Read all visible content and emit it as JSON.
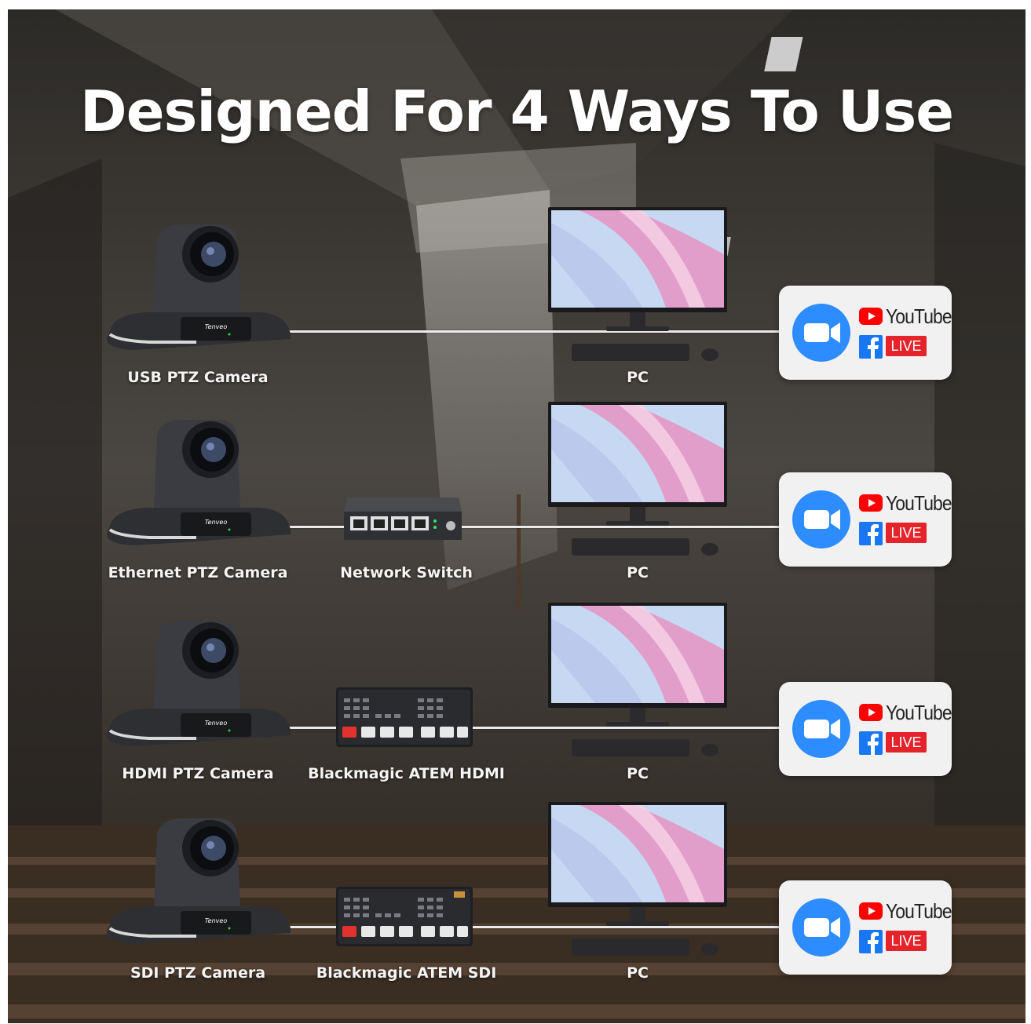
{
  "title": "Designed For 4 Ways To Use",
  "rows": [
    {
      "camera_label": "USB PTZ Camera",
      "device_label": "",
      "pc_label": "PC",
      "platforms": {
        "youtube": "YouTube",
        "live": "LIVE"
      }
    },
    {
      "camera_label": "Ethernet PTZ Camera",
      "device_label": "Network Switch",
      "pc_label": "PC",
      "platforms": {
        "youtube": "YouTube",
        "live": "LIVE"
      }
    },
    {
      "camera_label": "HDMI PTZ Camera",
      "device_label": "Blackmagic ATEM HDMI",
      "pc_label": "PC",
      "platforms": {
        "youtube": "YouTube",
        "live": "LIVE"
      }
    },
    {
      "camera_label": "SDI PTZ Camera",
      "device_label": "Blackmagic ATEM SDI",
      "pc_label": "PC",
      "platforms": {
        "youtube": "YouTube",
        "live": "LIVE"
      }
    }
  ],
  "camera_brand": "Tenveo",
  "icons": [
    "camera-icon",
    "network-switch-icon",
    "switcher-icon",
    "pc-monitor-icon",
    "keyboard-icon",
    "mouse-icon",
    "zoom-icon",
    "youtube-icon",
    "facebook-icon"
  ],
  "colors": {
    "zoom_blue": "#2d8cff",
    "youtube_red": "#ff0000",
    "facebook_blue": "#1877f2",
    "live_red": "#e5232b"
  }
}
